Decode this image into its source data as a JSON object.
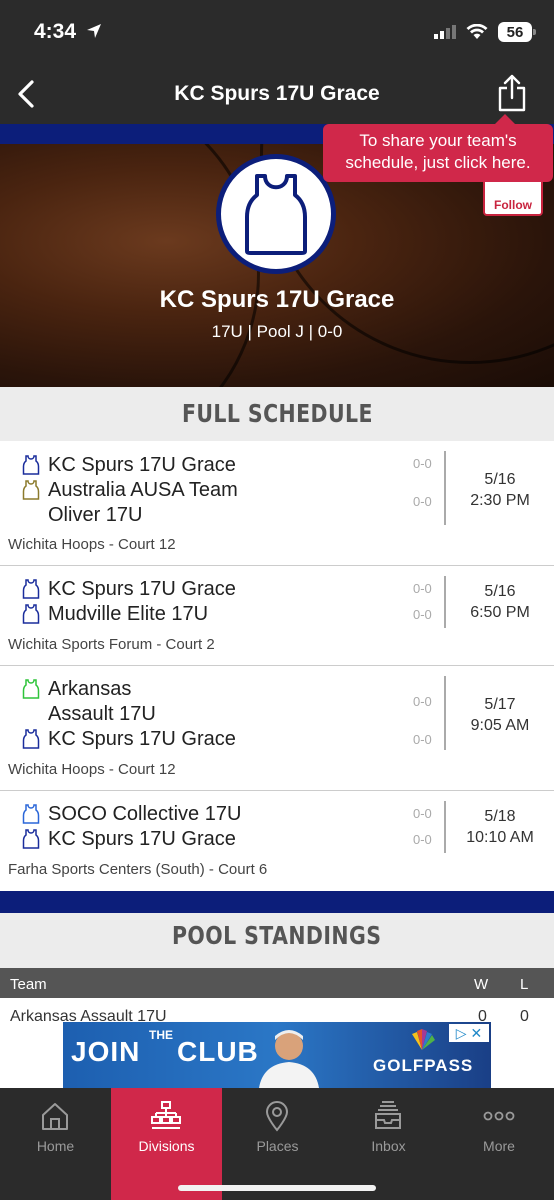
{
  "status_bar": {
    "time": "4:34",
    "battery": "56"
  },
  "nav": {
    "title": "KC Spurs 17U Grace"
  },
  "tooltip": {
    "line1": "To share your team's",
    "line2": "schedule, just click here."
  },
  "hero": {
    "team_name": "KC Spurs 17U Grace",
    "subtitle": "17U | Pool J | 0-0",
    "follow_label": "Follow"
  },
  "schedule": {
    "header": "FULL SCHEDULE",
    "games": [
      {
        "team1": "KC Spurs 17U Grace",
        "team1_jersey": "#1a2d9c",
        "team1_score": "0-0",
        "team2": "Australia AUSA Team Oliver 17U",
        "team2_jersey": "#8b7a2c",
        "team2_score": "0-0",
        "date": "5/16",
        "time": "2:30 PM",
        "venue": "Wichita Hoops - Court 12"
      },
      {
        "team1": "KC Spurs 17U Grace",
        "team1_jersey": "#1a2d9c",
        "team1_score": "0-0",
        "team2": "Mudville Elite 17U",
        "team2_jersey": "#1a2d9c",
        "team2_score": "0-0",
        "date": "5/16",
        "time": "6:50 PM",
        "venue": "Wichita Sports Forum - Court 2"
      },
      {
        "team1": "Arkansas Assault 17U",
        "team1_jersey": "#2ec43a",
        "team1_score": "0-0",
        "team2": "KC Spurs 17U Grace",
        "team2_jersey": "#1a2d9c",
        "team2_score": "0-0",
        "date": "5/17",
        "time": "9:05 AM",
        "venue": "Wichita Hoops - Court 12"
      },
      {
        "team1": "SOCO Collective 17U",
        "team1_jersey": "#2a66d8",
        "team1_score": "0-0",
        "team2": "KC Spurs 17U Grace",
        "team2_jersey": "#1a2d9c",
        "team2_score": "0-0",
        "date": "5/18",
        "time": "10:10 AM",
        "venue": "Farha Sports Centers (South) - Court 6"
      }
    ]
  },
  "standings": {
    "header": "POOL STANDINGS",
    "col_team": "Team",
    "col_w": "W",
    "col_l": "L",
    "rows": [
      {
        "team": "Arkansas Assault 17U",
        "w": "0",
        "l": "0"
      }
    ]
  },
  "ad": {
    "text1": "JOIN",
    "text2": "THE",
    "text3": "CLUB",
    "brand": "GOLFPASS",
    "close": "▷ ✕"
  },
  "tabs": [
    {
      "label": "Home",
      "icon": "home-icon"
    },
    {
      "label": "Divisions",
      "icon": "bracket-icon",
      "active": true
    },
    {
      "label": "Places",
      "icon": "map-pin-icon"
    },
    {
      "label": "Inbox",
      "icon": "inbox-icon"
    },
    {
      "label": "More",
      "icon": "more-icon"
    }
  ]
}
